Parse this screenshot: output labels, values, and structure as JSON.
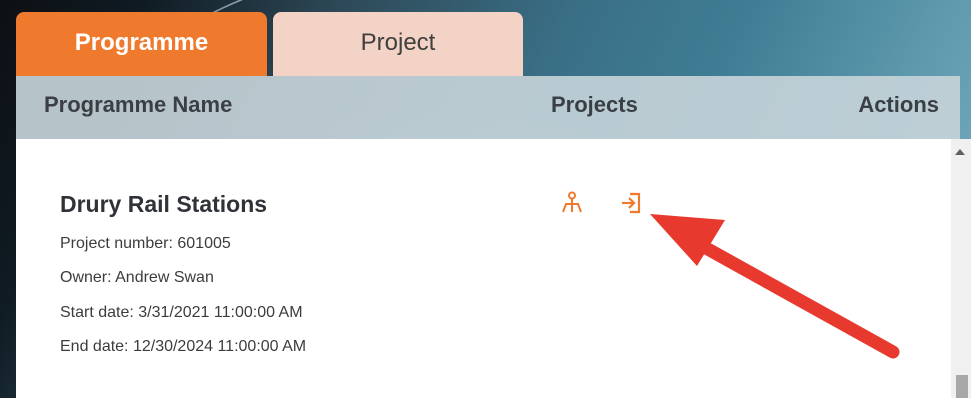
{
  "tabs": [
    {
      "label": "Programme",
      "active": true
    },
    {
      "label": "Project",
      "active": false
    }
  ],
  "table": {
    "headers": {
      "name": "Programme Name",
      "projects": "Projects",
      "actions": "Actions"
    },
    "rows": [
      {
        "title": "Drury Rail Stations",
        "project_number": "Project number: 601005",
        "owner": "Owner: Andrew Swan",
        "start_date": "Start date: 3/31/2021 11:00:00 AM",
        "end_date": "End date: 12/30/2024 11:00:00 AM",
        "icons": [
          "organization-structure-icon",
          "enter-project-icon"
        ]
      }
    ]
  },
  "colors": {
    "accent": "#ef7a2e",
    "tab_inactive": "#f3d3c6",
    "annotation_arrow": "#e8392f"
  }
}
